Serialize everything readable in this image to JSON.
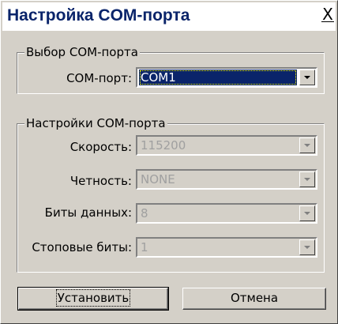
{
  "window": {
    "title": "Настройка COM-порта",
    "close_label": "X"
  },
  "port_group": {
    "title": "Выбор COM-порта",
    "port_label": "COM-порт:",
    "port_value": "COM1"
  },
  "settings_group": {
    "title": "Настройки COM-порта",
    "speed_label": "Скорость:",
    "speed_value": "115200",
    "parity_label": "Четность:",
    "parity_value": "NONE",
    "data_bits_label": "Биты данных:",
    "data_bits_value": "8",
    "stop_bits_label": "Стоповые биты:",
    "stop_bits_value": "1"
  },
  "buttons": {
    "apply_label": "Установить",
    "cancel_label": "Отмена"
  }
}
